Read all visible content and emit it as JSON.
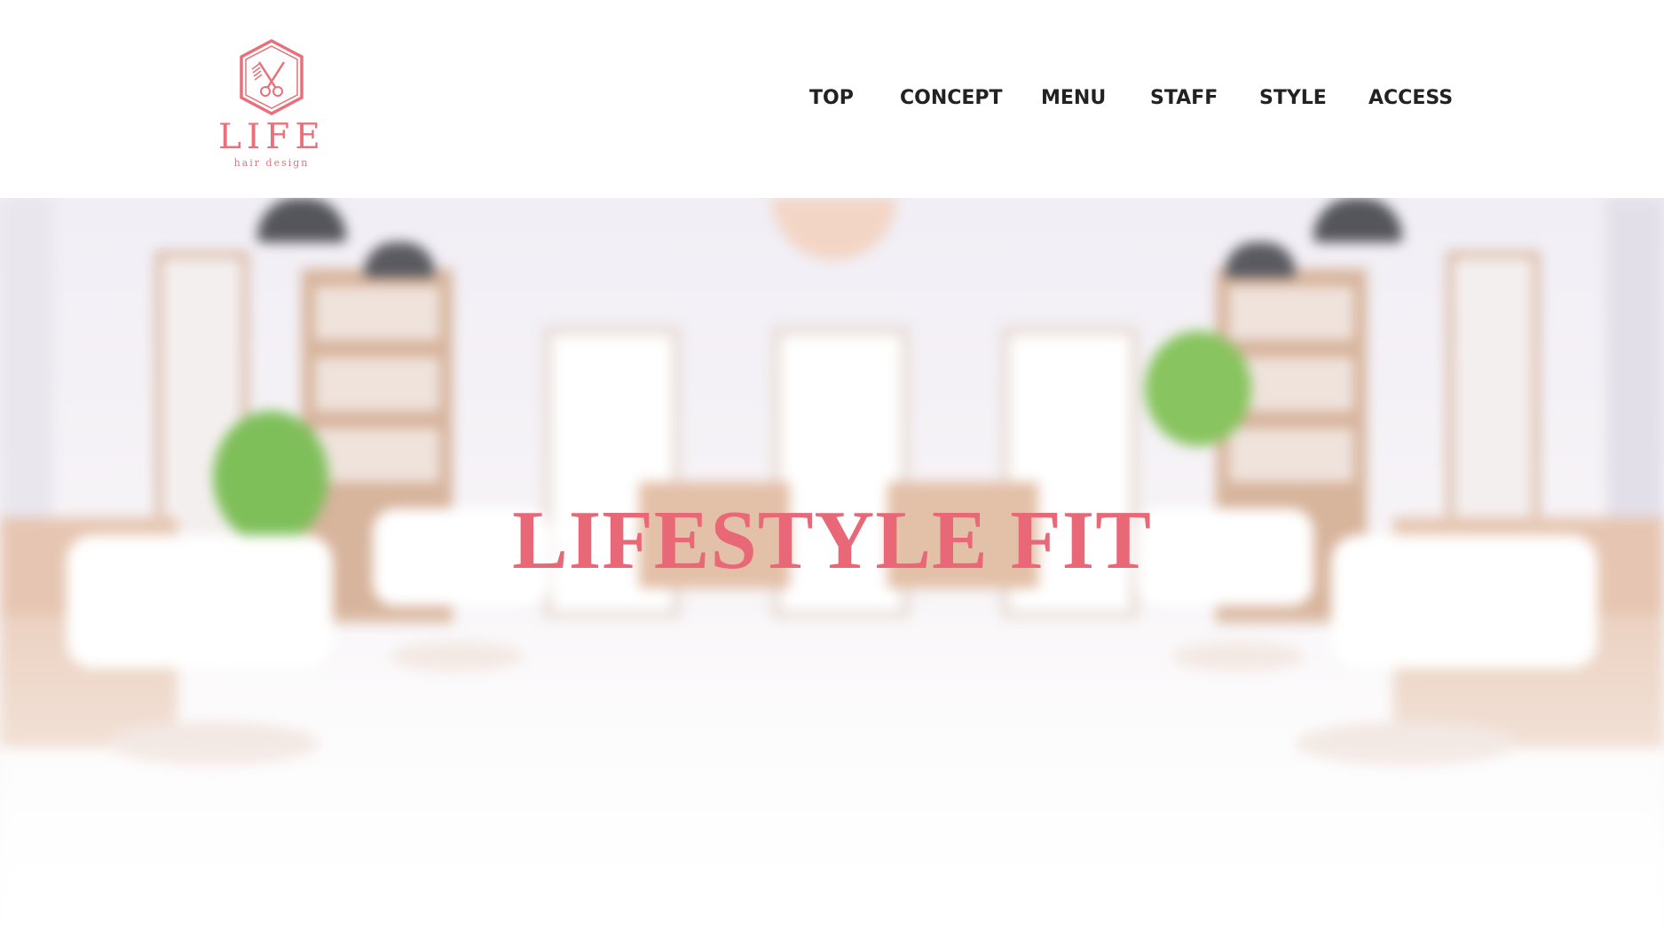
{
  "brand": {
    "name": "LIFE",
    "tagline": "hair design",
    "logo_icon": "scissors-hexagon-icon",
    "color": "#e8707a"
  },
  "nav": {
    "items": [
      {
        "label": "TOP"
      },
      {
        "label": "CONCEPT"
      },
      {
        "label": "MENU"
      },
      {
        "label": "STAFF"
      },
      {
        "label": "STYLE"
      },
      {
        "label": "ACCESS"
      }
    ]
  },
  "hero": {
    "title": "LIFESTYLE FIT",
    "title_color": "#e86878",
    "background": "blurred-salon-interior-photo"
  }
}
